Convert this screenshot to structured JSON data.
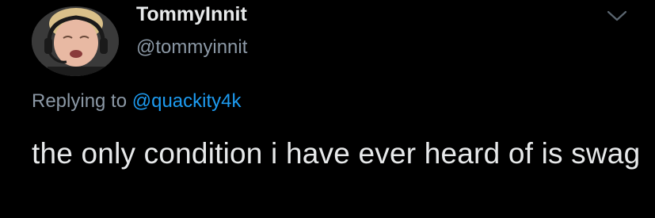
{
  "author": {
    "display_name": "TommyInnit",
    "handle": "@tommyinnit"
  },
  "reply": {
    "prefix": "Replying to",
    "mention": "@quackity4k"
  },
  "tweet": {
    "text": "the only condition i have ever heard of is swag"
  },
  "icons": {
    "menu": "chevron-down-icon",
    "avatar": "avatar"
  },
  "colors": {
    "background": "#000000",
    "text": "#e7e9ea",
    "secondary": "#8b98a5",
    "link": "#1d9bf0"
  }
}
